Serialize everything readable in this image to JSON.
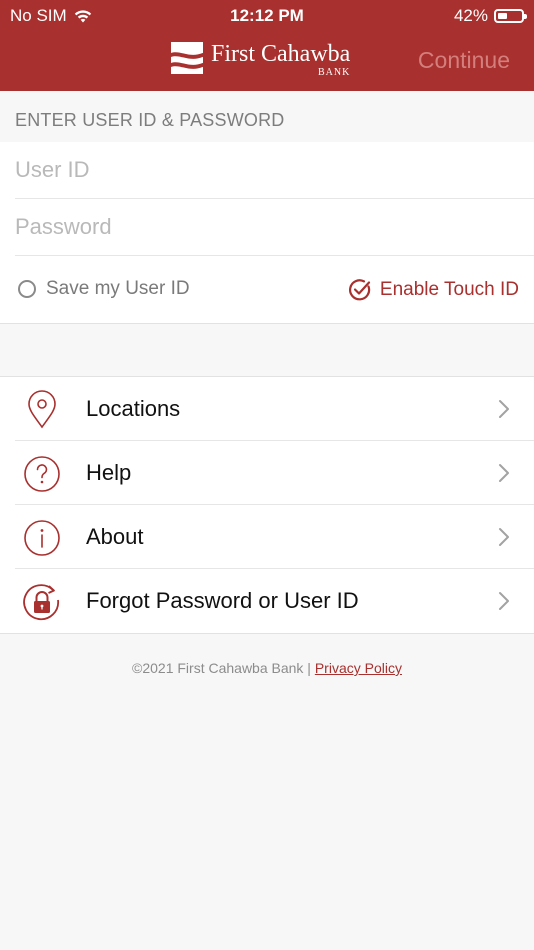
{
  "status_bar": {
    "carrier": "No SIM",
    "time": "12:12 PM",
    "battery": "42%",
    "battery_level": 0.42
  },
  "header": {
    "bank_name": "First Cahawba",
    "bank_sub": "BANK",
    "continue_label": "Continue"
  },
  "login": {
    "section_label": "ENTER USER ID & PASSWORD",
    "user_id_placeholder": "User ID",
    "password_placeholder": "Password",
    "save_user_label": "Save my User ID",
    "touch_id_label": "Enable Touch ID"
  },
  "menu": {
    "items": [
      {
        "label": "Locations",
        "icon": "location-pin-icon"
      },
      {
        "label": "Help",
        "icon": "question-icon"
      },
      {
        "label": "About",
        "icon": "info-icon"
      },
      {
        "label": "Forgot Password or User ID",
        "icon": "lock-refresh-icon"
      }
    ]
  },
  "footer": {
    "copyright": "©2021 First Cahawba Bank | ",
    "privacy_label": "Privacy Policy"
  },
  "colors": {
    "brand": "#a8302e",
    "background": "#f7f7f7"
  }
}
